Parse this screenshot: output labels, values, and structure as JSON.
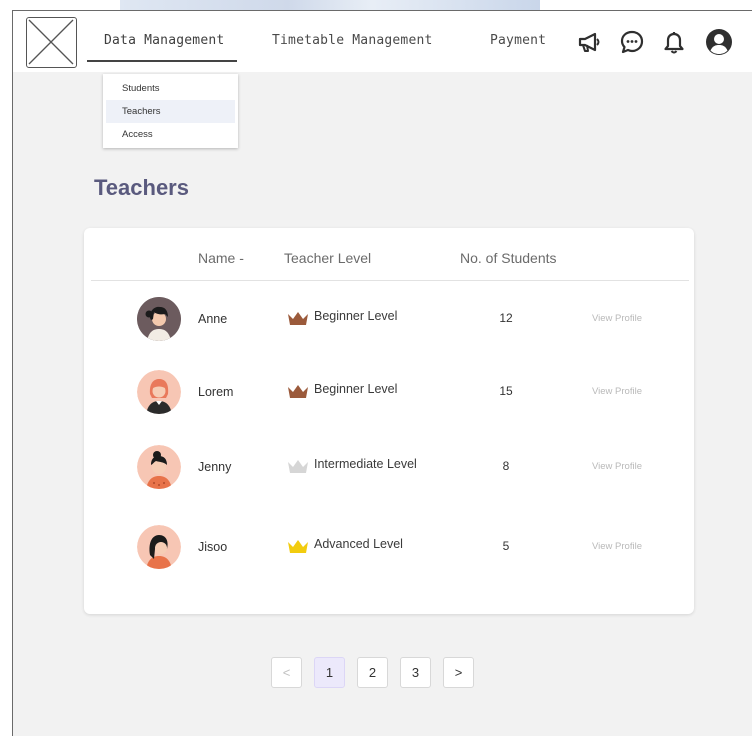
{
  "nav": {
    "items": [
      {
        "label": "Data Management",
        "active": true
      },
      {
        "label": "Timetable Management",
        "active": false
      },
      {
        "label": "Payment",
        "active": false
      }
    ],
    "icons": [
      "megaphone-icon",
      "chat-icon",
      "bell-icon",
      "user-icon"
    ]
  },
  "dropdown": {
    "items": [
      "Students",
      "Teachers",
      "Access"
    ],
    "selected": "Teachers"
  },
  "page": {
    "title": "Teachers"
  },
  "table": {
    "headers": [
      "Name -",
      "Teacher Level",
      "No. of Students"
    ],
    "rows": [
      {
        "name": "Anne",
        "level": "Beginner Level",
        "students": "12",
        "action": "View Profile",
        "crown_color": "#9b5a3b"
      },
      {
        "name": "Lorem",
        "level": "Beginner Level",
        "students": "15",
        "action": "View Profile",
        "crown_color": "#9b5a3b"
      },
      {
        "name": "Jenny",
        "level": "Intermediate Level",
        "students": "8",
        "action": "View Profile",
        "crown_color": "#d6d6d6"
      },
      {
        "name": "Jisoo",
        "level": "Advanced Level",
        "students": "5",
        "action": "View Profile",
        "crown_color": "#f2cc0f"
      }
    ]
  },
  "pagination": {
    "prev": "<",
    "pages": [
      "1",
      "2",
      "3"
    ],
    "current": "1",
    "next": ">"
  },
  "colors": {
    "title": "#5a5a7e",
    "page_bg": "#f2f2f2",
    "current_page": "#ece9fb"
  }
}
